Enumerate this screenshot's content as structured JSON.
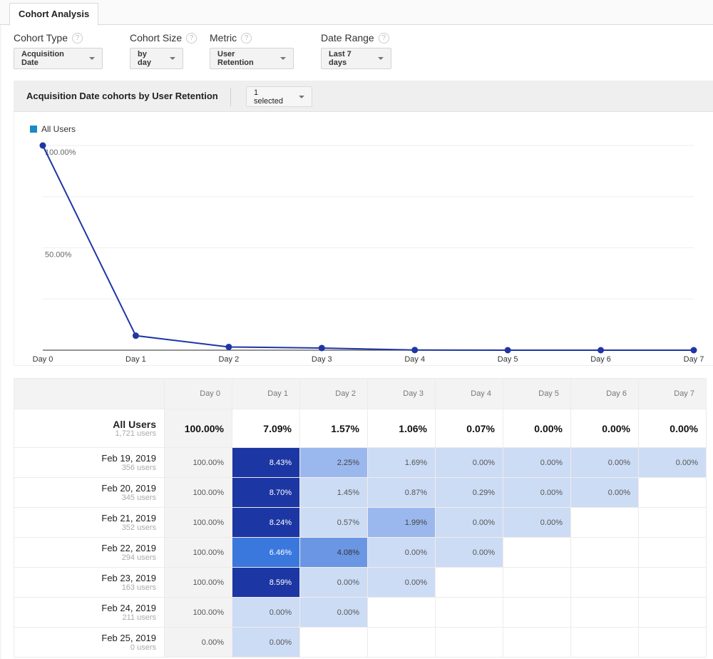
{
  "tab": {
    "label": "Cohort Analysis"
  },
  "controls": [
    {
      "label": "Cohort Type",
      "value": "Acquisition Date",
      "help": "?"
    },
    {
      "label": "Cohort Size",
      "value": "by day",
      "help": "?"
    },
    {
      "label": "Metric",
      "value": "User Retention",
      "help": "?"
    },
    {
      "label": "Date Range",
      "value": "Last 7 days",
      "help": "?"
    }
  ],
  "panel": {
    "title": "Acquisition Date cohorts by User Retention",
    "selector": "1 selected"
  },
  "chart_data": {
    "type": "line",
    "legend": [
      {
        "name": "All Users",
        "color": "#1a8ac6"
      }
    ],
    "legend_position": "top-left",
    "categories": [
      "Day 0",
      "Day 1",
      "Day 2",
      "Day 3",
      "Day 4",
      "Day 5",
      "Day 6",
      "Day 7"
    ],
    "series": [
      {
        "name": "All Users",
        "color": "#1f36a4",
        "values": [
          100.0,
          7.09,
          1.57,
          1.06,
          0.07,
          0.0,
          0.0,
          0.0
        ]
      }
    ],
    "yticks": [
      {
        "value": 100,
        "label": "100.00%"
      },
      {
        "value": 50,
        "label": "50.00%"
      }
    ],
    "gridlines": [
      0,
      25,
      50,
      75,
      100
    ],
    "ylim": [
      0,
      100
    ],
    "grid": true
  },
  "table": {
    "columns": [
      "Day 0",
      "Day 1",
      "Day 2",
      "Day 3",
      "Day 4",
      "Day 5",
      "Day 6",
      "Day 7"
    ],
    "total": {
      "label": "All Users",
      "users": "1,721 users",
      "values": [
        "100.00%",
        "7.09%",
        "1.57%",
        "1.06%",
        "0.07%",
        "0.00%",
        "0.00%",
        "0.00%"
      ]
    },
    "rows": [
      {
        "label": "Feb 19, 2019",
        "users": "356 users",
        "values": [
          "100.00%",
          "8.43%",
          "2.25%",
          "1.69%",
          "0.00%",
          "0.00%",
          "0.00%",
          "0.00%"
        ]
      },
      {
        "label": "Feb 20, 2019",
        "users": "345 users",
        "values": [
          "100.00%",
          "8.70%",
          "1.45%",
          "0.87%",
          "0.29%",
          "0.00%",
          "0.00%"
        ]
      },
      {
        "label": "Feb 21, 2019",
        "users": "352 users",
        "values": [
          "100.00%",
          "8.24%",
          "0.57%",
          "1.99%",
          "0.00%",
          "0.00%"
        ]
      },
      {
        "label": "Feb 22, 2019",
        "users": "294 users",
        "values": [
          "100.00%",
          "6.46%",
          "4.08%",
          "0.00%",
          "0.00%"
        ]
      },
      {
        "label": "Feb 23, 2019",
        "users": "163 users",
        "values": [
          "100.00%",
          "8.59%",
          "0.00%",
          "0.00%"
        ]
      },
      {
        "label": "Feb 24, 2019",
        "users": "211 users",
        "values": [
          "100.00%",
          "0.00%",
          "0.00%"
        ]
      },
      {
        "label": "Feb 25, 2019",
        "users": "0 users",
        "values": [
          "0.00%",
          "0.00%"
        ]
      }
    ],
    "heat_colors": {
      "darkest": "#1c37a3",
      "dark": "#3a78de",
      "mid": "#6b96e4",
      "light": "#9ab8ed",
      "lightest": "#cddcf5"
    }
  }
}
